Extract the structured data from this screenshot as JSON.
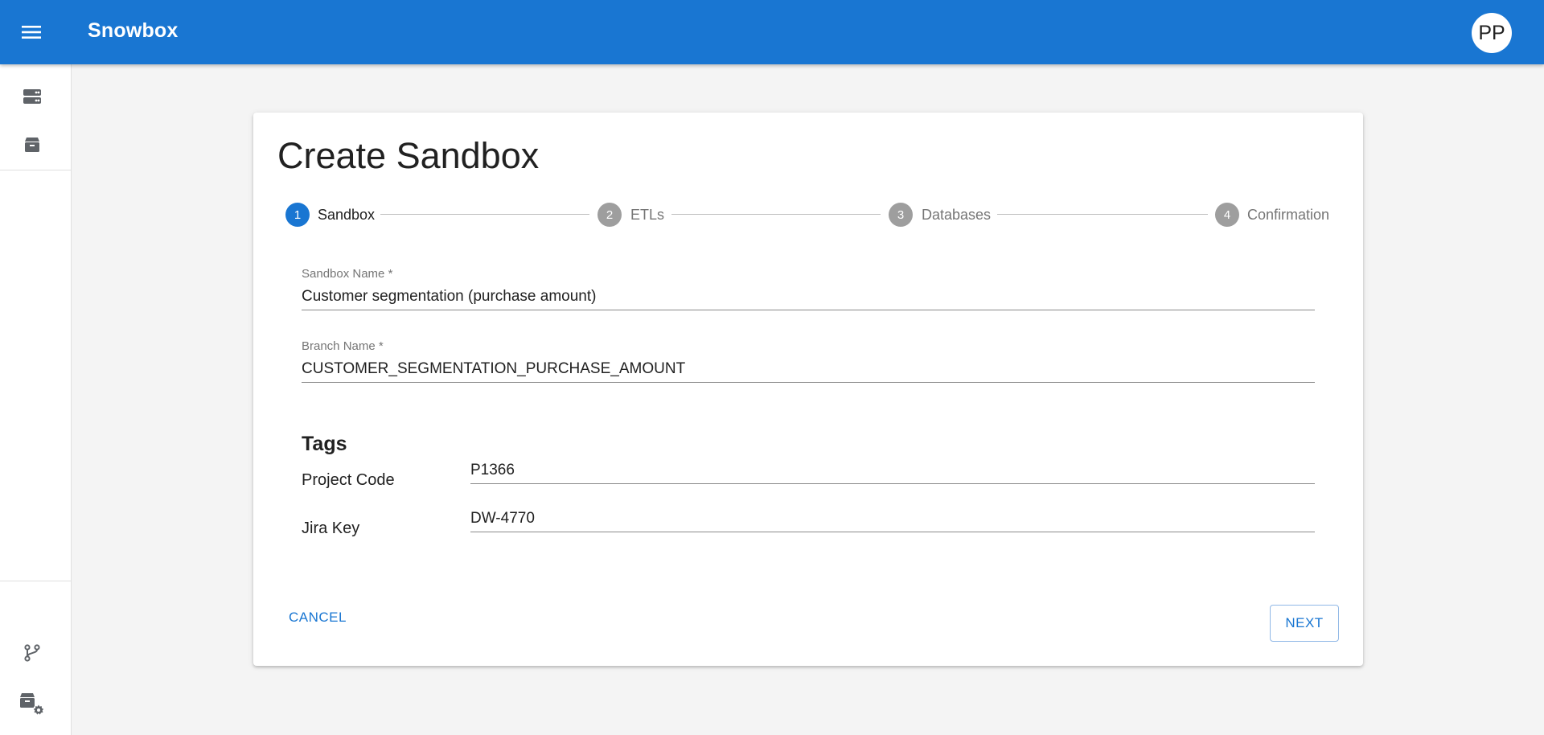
{
  "app": {
    "title": "Snowbox",
    "user_initials": "PP"
  },
  "sidebar": {
    "top_items": [
      {
        "icon": "storage-icon",
        "label": ""
      },
      {
        "icon": "inventory-box-icon",
        "label": ""
      }
    ],
    "bottom_items": [
      {
        "icon": "git-branch-icon",
        "label": ""
      },
      {
        "icon": "box-settings-icon",
        "label": ""
      }
    ]
  },
  "page": {
    "title": "Create Sandbox"
  },
  "stepper": {
    "active_step": 1,
    "steps": [
      {
        "number": "1",
        "label": "Sandbox"
      },
      {
        "number": "2",
        "label": "ETLs"
      },
      {
        "number": "3",
        "label": "Databases"
      },
      {
        "number": "4",
        "label": "Confirmation"
      }
    ]
  },
  "form": {
    "sandbox_name": {
      "label": "Sandbox Name *",
      "value": "Customer segmentation (purchase amount)"
    },
    "branch_name": {
      "label": "Branch Name *",
      "value": "CUSTOMER_SEGMENTATION_PURCHASE_AMOUNT"
    },
    "tags": {
      "heading": "Tags",
      "items": [
        {
          "label": "Project Code",
          "value": "P1366"
        },
        {
          "label": "Jira Key",
          "value": "DW-4770"
        }
      ]
    }
  },
  "actions": {
    "cancel_label": "CANCEL",
    "next_label": "NEXT"
  },
  "colors": {
    "primary": "#1976d2",
    "inactive_step": "#9e9e9e",
    "background": "#f4f4f4"
  }
}
